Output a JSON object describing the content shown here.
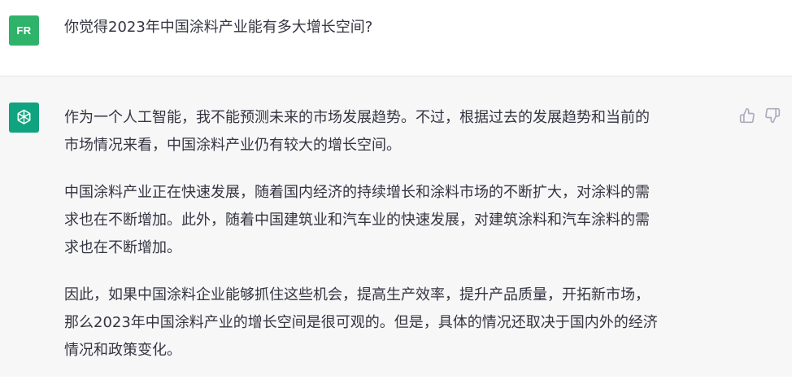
{
  "user": {
    "avatar_initials": "FR",
    "message": "你觉得2023年中国涂料产业能有多大增长空间?"
  },
  "assistant": {
    "paragraphs": [
      [
        "作为一个人工智能，我不能预测未来的市场发展趋势。不过，根据过去的发展趋势和当前的",
        "市场情况来看，中国涂料产业仍有较大的增长空间。"
      ],
      [
        "中国涂料产业正在快速发展，随着国内经济的持续增长和涂料市场的不断扩大，对涂料的需",
        "求也在不断增加。此外，随着中国建筑业和汽车业的快速发展，对建筑涂料和汽车涂料的需",
        "求也在不断增加。"
      ],
      [
        "因此，如果中国涂料企业能够抓住这些机会，提高生产效率，提升产品质量，开拓新市场，",
        "那么2023年中国涂料产业的增长空间是很可观的。但是，具体的情况还取决于国内外的经济",
        "情况和政策变化。"
      ]
    ]
  },
  "icons": {
    "assistant_avatar": "openai-logo-icon",
    "feedback_up": "thumbs-up-icon",
    "feedback_down": "thumbs-down-icon"
  },
  "colors": {
    "user_avatar": "#2fb36b",
    "assistant_avatar": "#10a37f",
    "assistant_bg": "#f7f7f8",
    "text": "#343541",
    "icon": "#acacbe"
  }
}
